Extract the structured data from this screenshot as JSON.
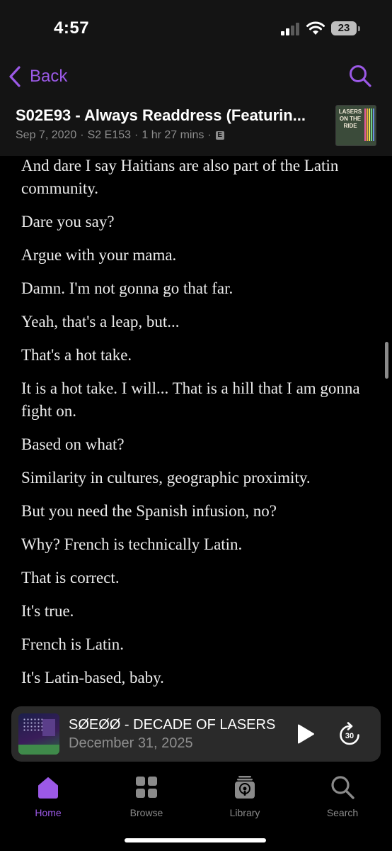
{
  "status_bar": {
    "time": "4:57",
    "battery_level": "23"
  },
  "header": {
    "back_label": "Back",
    "episode_title": "S02E93 - Always Readdress (Featurin...",
    "date": "Sep 7, 2020",
    "episode_code": "S2 E153",
    "duration": "1 hr 27 mins",
    "explicit_badge": "E",
    "separator": "·",
    "artwork_text": "LASERS ON THE RIDE",
    "accent_color": "#9b59e6"
  },
  "transcript": {
    "lines": [
      "And dare I say Haitians are also part of the Latin community.",
      "Dare you say?",
      "Argue with your mama.",
      "Damn. I'm not gonna go that far.",
      "Yeah, that's a leap, but...",
      "That's a hot take.",
      "It is a hot take. I will... That is a hill that I am gonna fight on.",
      "Based on what?",
      "Similarity in cultures, geographic proximity.",
      "But you need the Spanish infusion, no?",
      "Why? French is technically Latin.",
      "That is correct.",
      "It's true.",
      "French is Latin.",
      "It's Latin-based, baby."
    ]
  },
  "mini_player": {
    "title": "SØEØØ - DECADE OF LASERS",
    "subtitle": "December 31, 2025",
    "skip_seconds": "30"
  },
  "tab_bar": {
    "tabs": [
      {
        "label": "Home",
        "icon": "home-icon",
        "active": true
      },
      {
        "label": "Browse",
        "icon": "browse-grid-icon",
        "active": false
      },
      {
        "label": "Library",
        "icon": "library-podcast-icon",
        "active": false
      },
      {
        "label": "Search",
        "icon": "search-icon",
        "active": false
      }
    ]
  }
}
